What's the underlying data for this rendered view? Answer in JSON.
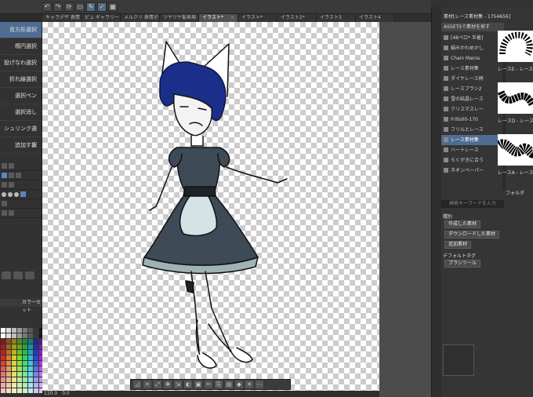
{
  "toolbar": {
    "icons": [
      "undo-icon",
      "redo-icon",
      "rotate-icon",
      "select-icon",
      "pen-icon",
      "check-icon",
      "grid-icon"
    ]
  },
  "tabs": [
    {
      "label": "キャラデザ 表情 レ×",
      "active": false
    },
    {
      "label": "ピュ ギャラリー×",
      "active": false
    },
    {
      "label": "メルクリ 表情ポー×",
      "active": false
    },
    {
      "label": "ツヤツヤ髪表現 ×",
      "active": false
    },
    {
      "label": "イラスト*",
      "active": true
    },
    {
      "label": "イラスト*",
      "active": false
    },
    {
      "label": "イラスト2*",
      "active": false
    },
    {
      "label": "イラスト3",
      "active": false
    },
    {
      "label": "イラスト4",
      "active": false
    }
  ],
  "selection_tools": [
    {
      "label": "長方形選択",
      "active": true
    },
    {
      "label": "楕円選択",
      "active": false
    },
    {
      "label": "投げなわ選択",
      "active": false
    },
    {
      "label": "折れ線選択",
      "active": false
    },
    {
      "label": "選択ペン",
      "active": false
    },
    {
      "label": "選択消し",
      "active": false
    },
    {
      "label": "シュリンク選択",
      "active": false
    },
    {
      "label": "追加する",
      "active": false
    }
  ],
  "palette_title": "カラーセット",
  "bottom_status": {
    "zoom": "110.0",
    "angle": "0.0"
  },
  "assets": {
    "header": "素材[レース素材集 - 1754656]",
    "root": "ASSETSで素材を探す",
    "tree": [
      {
        "label": "[48ベロ* 半着]",
        "active": false
      },
      {
        "label": "絹みかわめかし",
        "active": false
      },
      {
        "label": "Chain Mania",
        "active": false
      },
      {
        "label": "レース素材集",
        "active": false
      },
      {
        "label": "ダイヤレース柄",
        "active": false
      },
      {
        "label": "レースブラシ2",
        "active": false
      },
      {
        "label": "雪の結晶レース",
        "active": false
      },
      {
        "label": "クリスマスレー",
        "active": false
      },
      {
        "label": "Frills00-170",
        "active": false
      },
      {
        "label": "フリルとレース",
        "active": false
      },
      {
        "label": "レース素材集",
        "active": true
      },
      {
        "label": "ハートレース",
        "active": false
      },
      {
        "label": "らくがきに合う",
        "active": false
      },
      {
        "label": "ネオンペーパー",
        "active": false
      }
    ],
    "search_placeholder": "検索キーワードを入力",
    "category_label": "種別",
    "category_chips": [
      "作成した素材",
      "ダウンロードした素材",
      "追加素材"
    ],
    "default_tag_label": "デフォルトタグ",
    "tag_chips": [
      "ブラシツール"
    ],
    "thumbnails": [
      {
        "label": "レースE - レース素材"
      },
      {
        "label": "レースD - レース素材"
      },
      {
        "label": "レースA - レース素材"
      }
    ],
    "folder_label": "フォルダ"
  },
  "colors": {
    "accent": "#4f6c92",
    "hair": "#1b2f8a",
    "dress": "#3e4a55",
    "dress_light": "#9fb2b6",
    "apron": "#d3e3e6"
  }
}
